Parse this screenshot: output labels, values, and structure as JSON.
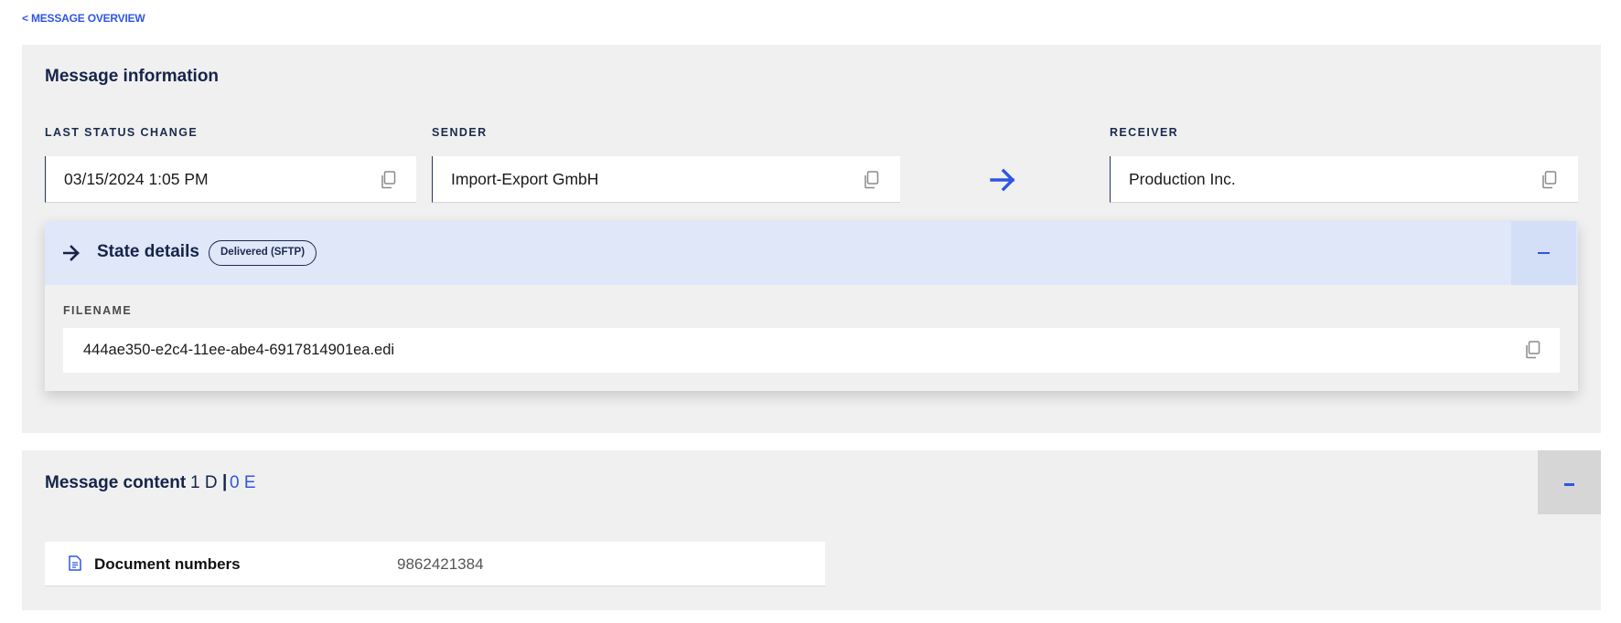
{
  "nav": {
    "back_label": "< MESSAGE OVERVIEW"
  },
  "info": {
    "title": "Message information",
    "last_status": {
      "label": "LAST STATUS CHANGE",
      "value": "03/15/2024 1:05 PM"
    },
    "sender": {
      "label": "SENDER",
      "value": "Import-Export GmbH"
    },
    "receiver": {
      "label": "RECEIVER",
      "value": "Production Inc."
    },
    "state": {
      "title": "State details",
      "badge": "Delivered (SFTP)",
      "collapse_symbol": "−",
      "filename_label": "FILENAME",
      "filename_value": "444ae350-e2c4-11ee-abe4-6917814901ea.edi"
    }
  },
  "content": {
    "title": "Message content",
    "count_d": "1 D",
    "separator": "|",
    "count_e": "0 E",
    "collapse_symbol": "-",
    "doc_label": "Document numbers",
    "doc_value": "9862421384"
  },
  "colors": {
    "accent": "#2f56e3",
    "navy": "#16244a",
    "panel": "#f0f0f0",
    "state_header": "#dfe7f8"
  },
  "icons": [
    "copy-icon",
    "arrow-right-icon",
    "document-icon"
  ]
}
